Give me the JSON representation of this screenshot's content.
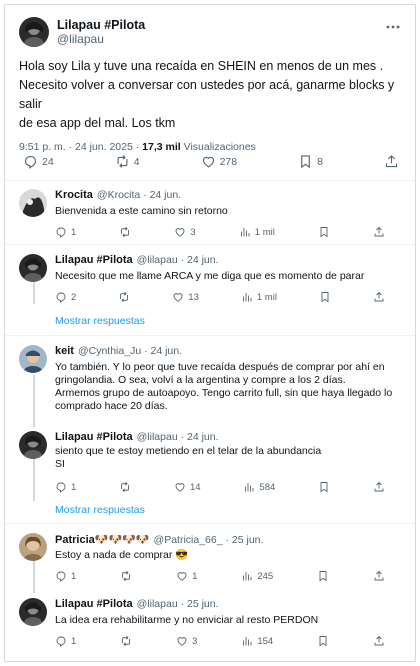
{
  "main": {
    "author_name": "Lilapau #Pilota",
    "author_handle": "@lilapau",
    "text_line1": "Hola soy Lila y tuve una recaída en SHEIN en menos de un mes .",
    "text_line2": "Necesito volver a conversar con ustedes por acá, ganarme blocks y salir",
    "text_line3": "de esa app del mal. Los tkm",
    "time_date": "9:51 p. m. · 24 jun. 2025 ·",
    "views_count": "17,3 mil",
    "views_label": "Visualizaciones",
    "replies": "24",
    "reposts": "4",
    "likes": "278",
    "bookmarks": "8"
  },
  "replies": [
    {
      "name": "Krocita",
      "handle": "@Krocita · 24 jun.",
      "text": [
        "Bienvenida a este camino sin retorno"
      ],
      "replies": "1",
      "reposts": "",
      "likes": "3",
      "views": "1 mil"
    },
    {
      "name": "Lilapau #Pilota",
      "handle": "@lilapau · 24 jun.",
      "text": [
        "Necesito que me llame ARCA y me diga  que es momento de parar"
      ],
      "replies": "2",
      "reposts": "",
      "likes": "13",
      "views": "1 mil"
    },
    {
      "name": "keit",
      "handle": "@Cynthia_Ju · 24 jun.",
      "text": [
        "Yo también.  Y lo peor que tuve recaída después de comprar por ahí en",
        "gringolandia. O sea, volví a la argentina y compre a los 2 días.",
        "Armemos grupo de autoapoyo. Tengo carrito full, sin que haya llegado lo",
        "comprado hace 20 días."
      ],
      "replies": "",
      "reposts": "",
      "likes": "",
      "views": ""
    },
    {
      "name": "Lilapau #Pilota",
      "handle": "@lilapau · 24 jun.",
      "text": [
        "siento que te estoy metiendo en el telar de la abundancia",
        "SI"
      ],
      "replies": "1",
      "reposts": "",
      "likes": "14",
      "views": "584"
    },
    {
      "name": "Patricia🐶🐶🐶🐶",
      "handle": "@Patricia_66_ · 25 jun.",
      "text": [
        "Estoy a nada de comprar 😎"
      ],
      "replies": "1",
      "reposts": "",
      "likes": "1",
      "views": "245"
    },
    {
      "name": "Lilapau #Pilota",
      "handle": "@lilapau · 25 jun.",
      "text": [
        "La idea era rehabilitarme y no enviciar al resto PERDON"
      ],
      "replies": "1",
      "reposts": "",
      "likes": "3",
      "views": "154"
    }
  ],
  "show_replies_label": "Mostrar respuestas",
  "colors": {
    "accent": "#1d9bf0",
    "muted": "#536471",
    "text": "#0f1419",
    "border": "#eff3f4"
  }
}
